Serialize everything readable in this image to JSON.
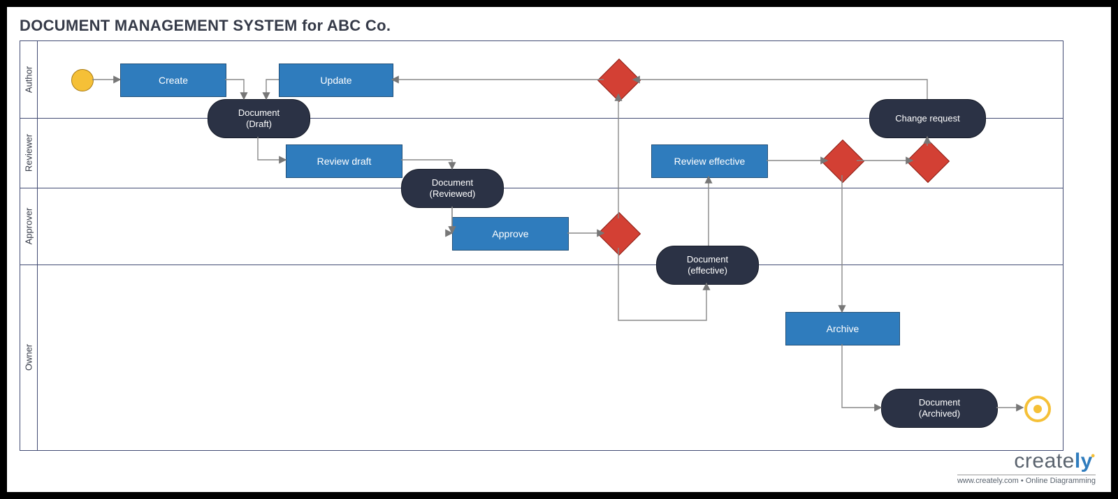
{
  "title": "DOCUMENT MANAGEMENT SYSTEM for ABC Co.",
  "lanes": {
    "author": "Author",
    "reviewer": "Reviewer",
    "approver": "Approver",
    "owner": "Owner"
  },
  "nodes": {
    "create": "Create",
    "update": "Update",
    "doc_draft_l1": "Document",
    "doc_draft_l2": "(Draft)",
    "review_draft": "Review draft",
    "doc_reviewed_l1": "Document",
    "doc_reviewed_l2": "(Reviewed)",
    "approve": "Approve",
    "review_eff": "Review effective",
    "doc_eff_l1": "Document",
    "doc_eff_l2": "(effective)",
    "change_req": "Change request",
    "archive": "Archive",
    "doc_arch_l1": "Document",
    "doc_arch_l2": "(Archived)"
  },
  "footer": {
    "brand_a": "create",
    "brand_b": "ly",
    "tagline": "www.creately.com • Online Diagramming"
  },
  "colors": {
    "activity": "#2f7cbd",
    "object": "#2b3245",
    "decision": "#d34034",
    "startend": "#f5c037",
    "border": "#424b73"
  }
}
